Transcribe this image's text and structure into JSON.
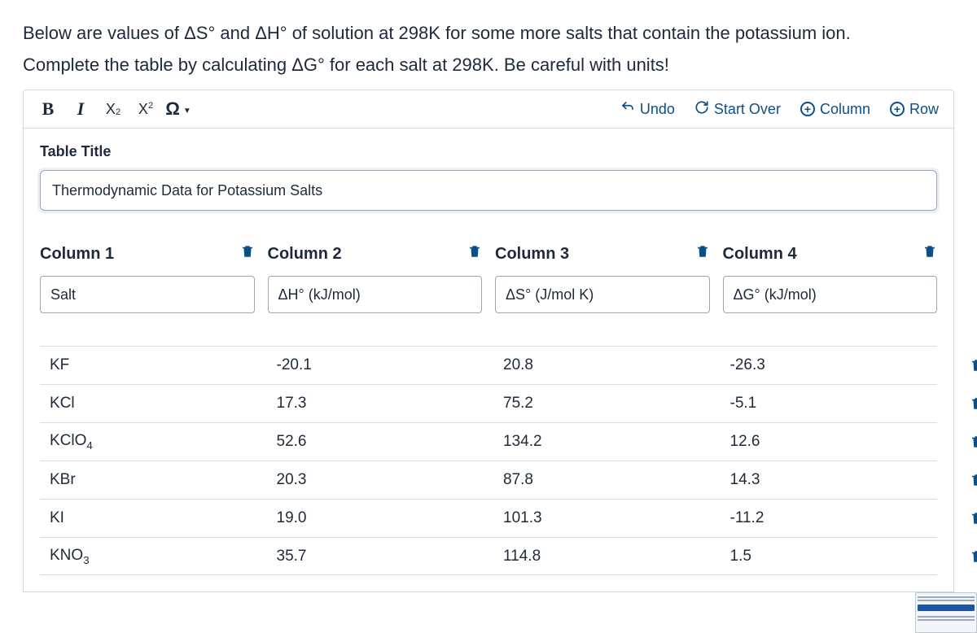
{
  "question": {
    "line1": "Below are values of  ΔS° and ΔH° of solution at 298K for some more salts that contain the potassium ion.",
    "line2": "Complete the table by calculating ΔG° for each salt at 298K.  Be careful with units!"
  },
  "toolbar": {
    "bold": "B",
    "italic": "I",
    "subscript": "X",
    "superscript": "X",
    "omega": "Ω",
    "undo": "Undo",
    "startover": "Start Over",
    "addcol": "Column",
    "addrow": "Row"
  },
  "table_title_label": "Table Title",
  "table_title_value": "Thermodynamic Data for Potassium Salts",
  "columns": [
    {
      "label": "Column 1",
      "header": "Salt"
    },
    {
      "label": "Column 2",
      "header": "ΔH° (kJ/mol)"
    },
    {
      "label": "Column 3",
      "header": "ΔS° (J/mol K)"
    },
    {
      "label": "Column 4",
      "header": "ΔG° (kJ/mol)"
    }
  ],
  "rows": [
    {
      "c1": "KF",
      "c2": "-20.1",
      "c3": "20.8",
      "c4": "-26.3"
    },
    {
      "c1": "KCl",
      "c2": "17.3",
      "c3": "75.2",
      "c4": "-5.1"
    },
    {
      "c1": "KClO4",
      "c1_display": "KClO<sub>4</sub>",
      "c2": "52.6",
      "c3": "134.2",
      "c4": "12.6"
    },
    {
      "c1": "KBr",
      "c2": "20.3",
      "c3": "87.8",
      "c4": "14.3"
    },
    {
      "c1": "KI",
      "c2": "19.0",
      "c3": "101.3",
      "c4": "-11.2"
    },
    {
      "c1": "KNO3",
      "c1_display": "KNO<sub>3</sub>",
      "c2": "35.7",
      "c3": "114.8",
      "c4": "1.5"
    }
  ],
  "colors": {
    "link": "#0b4f8a"
  }
}
